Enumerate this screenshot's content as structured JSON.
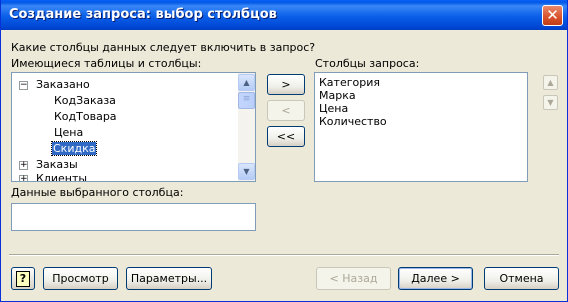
{
  "window": {
    "title": "Создание запроса: выбор столбцов",
    "close_glyph": "✕"
  },
  "prompt": "Какие столбцы данных следует включить в запрос?",
  "available": {
    "label": "Имеющиеся таблицы и столбцы:",
    "tree": [
      {
        "label": "Заказано",
        "toggle": "−"
      },
      {
        "label": "КодЗаказа"
      },
      {
        "label": "КодТовара"
      },
      {
        "label": "Цена"
      },
      {
        "label": "Скидка",
        "selected": true
      },
      {
        "label": "Заказы",
        "toggle": "+"
      },
      {
        "label": "Клиенты",
        "toggle": "+"
      }
    ]
  },
  "move_buttons": {
    "add": ">",
    "remove": "<",
    "remove_all": "<<"
  },
  "query": {
    "label": "Столбцы запроса:",
    "items": [
      "Категория",
      "Марка",
      "Цена",
      "Количество"
    ]
  },
  "column_data": {
    "label": "Данные выбранного столбца:",
    "value": ""
  },
  "footer": {
    "help": "?",
    "preview": "Просмотр",
    "options": "Параметры...",
    "back": "< Назад",
    "next": "Далее >",
    "cancel": "Отмена"
  },
  "icons": {
    "tree_scroll": [
      "scroll-up-arrow-icon",
      "scroll-thumb-grip-icon",
      "scroll-down-arrow-icon"
    ],
    "order": [
      "move-up-arrow-icon",
      "move-down-arrow-icon"
    ],
    "help": "help-book-icon"
  },
  "colors": {
    "titlebar": "#0058e6",
    "selection": "#316ac5",
    "dialog_bg": "#ece9d8"
  }
}
